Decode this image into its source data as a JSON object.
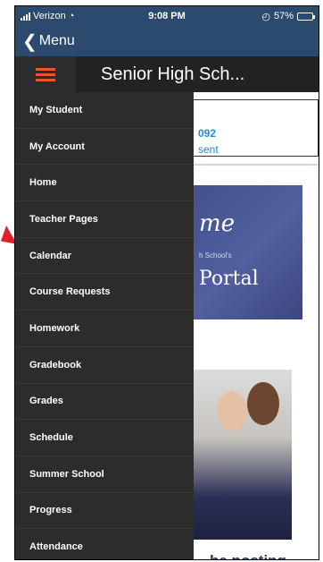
{
  "status_bar": {
    "carrier": "Verizon",
    "time": "9:08 PM",
    "battery_text": "57%",
    "battery_level": 0.57
  },
  "nav": {
    "back_label": "Menu"
  },
  "header": {
    "title": "Senior High Sch..."
  },
  "content": {
    "id_number_partial": "092",
    "status_partial": "sent",
    "banner_word_partial": "me",
    "banner_small_partial": "h School's",
    "banner_portal_partial": "Portal",
    "posting_partial": "be posting"
  },
  "menu": {
    "items": [
      "My Student",
      "My Account",
      "Home",
      "Teacher Pages",
      "Calendar",
      "Course Requests",
      "Homework",
      "Gradebook",
      "Grades",
      "Schedule",
      "Summer School",
      "Progress",
      "Attendance"
    ]
  },
  "colors": {
    "navbar": "#2b4a6e",
    "menu_bg": "#2c2c2c",
    "hamburger_accent": "#e8572b",
    "link_blue": "#1f8bd6",
    "arrow_red": "#e0202a"
  }
}
